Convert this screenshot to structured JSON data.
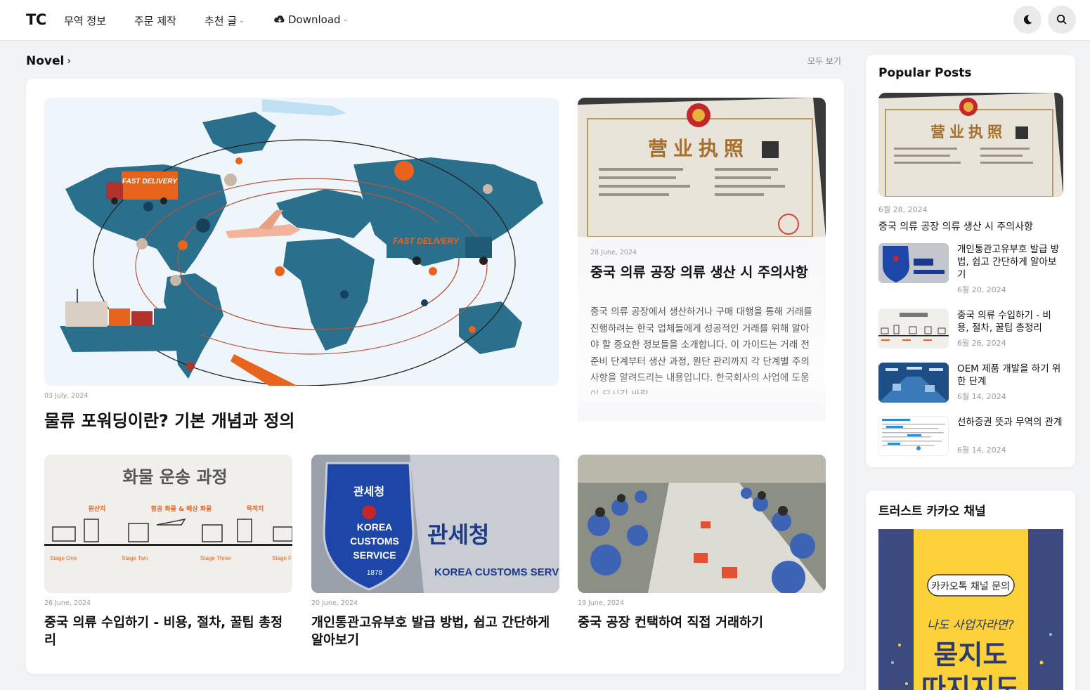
{
  "header": {
    "logo": "TC",
    "nav": [
      "무역 정보",
      "주문 제작",
      "추천 글",
      "Download"
    ]
  },
  "section": {
    "title": "Novel",
    "view_all": "모두 보기"
  },
  "featured": {
    "date": "03 July, 2024",
    "title": "물류 포워딩이란? 기본 개념과 정의",
    "image_text": [
      "FAST DELIVERY",
      "FAST DELIVERY"
    ]
  },
  "cert_post": {
    "date": "28 June, 2024",
    "title": "중국 의류 공장 의류 생산 시 주의사항",
    "excerpt": "중국 의류 공장에서 생산하거나 구매 대행을 통해 거래를 진행하려는 한국 업체들에게 성공적인 거래를 위해 알아야 할 중요한 정보들을 소개합니다. 이 가이드는 거래 전 준비 단계부터 생산 과정, 원단 관리까지 각 단계별 주의사항을 알려드리는 내용입니다. 한국회사의 사업에 도움이 되시길 바랍",
    "image_text": "营业执照"
  },
  "row_posts": [
    {
      "date": "26 June, 2024",
      "title": "중국 의류 수입하기 - 비용, 절차, 꿀팁 총정리",
      "image_heading": "화물 운송 과정",
      "image_labels": [
        "원산지",
        "항공 화물 & 해상 화물",
        "목적지"
      ],
      "image_stages": [
        "Stage One",
        "Stage Two",
        "Stage Three",
        "Stage F"
      ]
    },
    {
      "date": "20 June, 2024",
      "title": "개인통관고유부호 발급 방법, 쉽고 간단하게 알아보기",
      "image_badge": [
        "관세청",
        "KOREA",
        "CUSTOMS",
        "SERVICE",
        "1878"
      ],
      "image_wall": [
        "관세청",
        "KOREA CUSTOMS SERVICE"
      ]
    },
    {
      "date": "19 June, 2024",
      "title": "중국 공장 컨택하여 직접 거래하기"
    }
  ],
  "sidebar": {
    "popular_heading": "Popular Posts",
    "main": {
      "date": "6월 28, 2024",
      "title": "중국 의류 공장 의류 생산 시 주의사항",
      "image_text": "营业执照"
    },
    "items": [
      {
        "title": "개인통관고유부호 발급 방법, 쉽고 간단하게 알아보기",
        "date": "6월 20, 2024"
      },
      {
        "title": "중국 의류 수입하기 - 비용, 절차, 꿀팁 총정리",
        "date": "6월 26, 2024"
      },
      {
        "title": "OEM 제품 개발을 하기 위한 단계",
        "date": "6월 14, 2024"
      },
      {
        "title": "선하증권 뜻과 무역의 관계",
        "date": "6월 14, 2024"
      }
    ],
    "kakao_heading": "트러스트 카카오 채널",
    "kakao_banner": {
      "button": "카카오톡 채널 문의",
      "subtitle": "나도 사업자라면?",
      "headline_1": "묻지도",
      "headline_2": "따지지도"
    }
  },
  "colors": {
    "accent_orange": "#e8641c",
    "map_blue": "#2a6f8c",
    "kakao_yellow": "#fcd13a",
    "kakao_navy": "#3d4a7f"
  }
}
